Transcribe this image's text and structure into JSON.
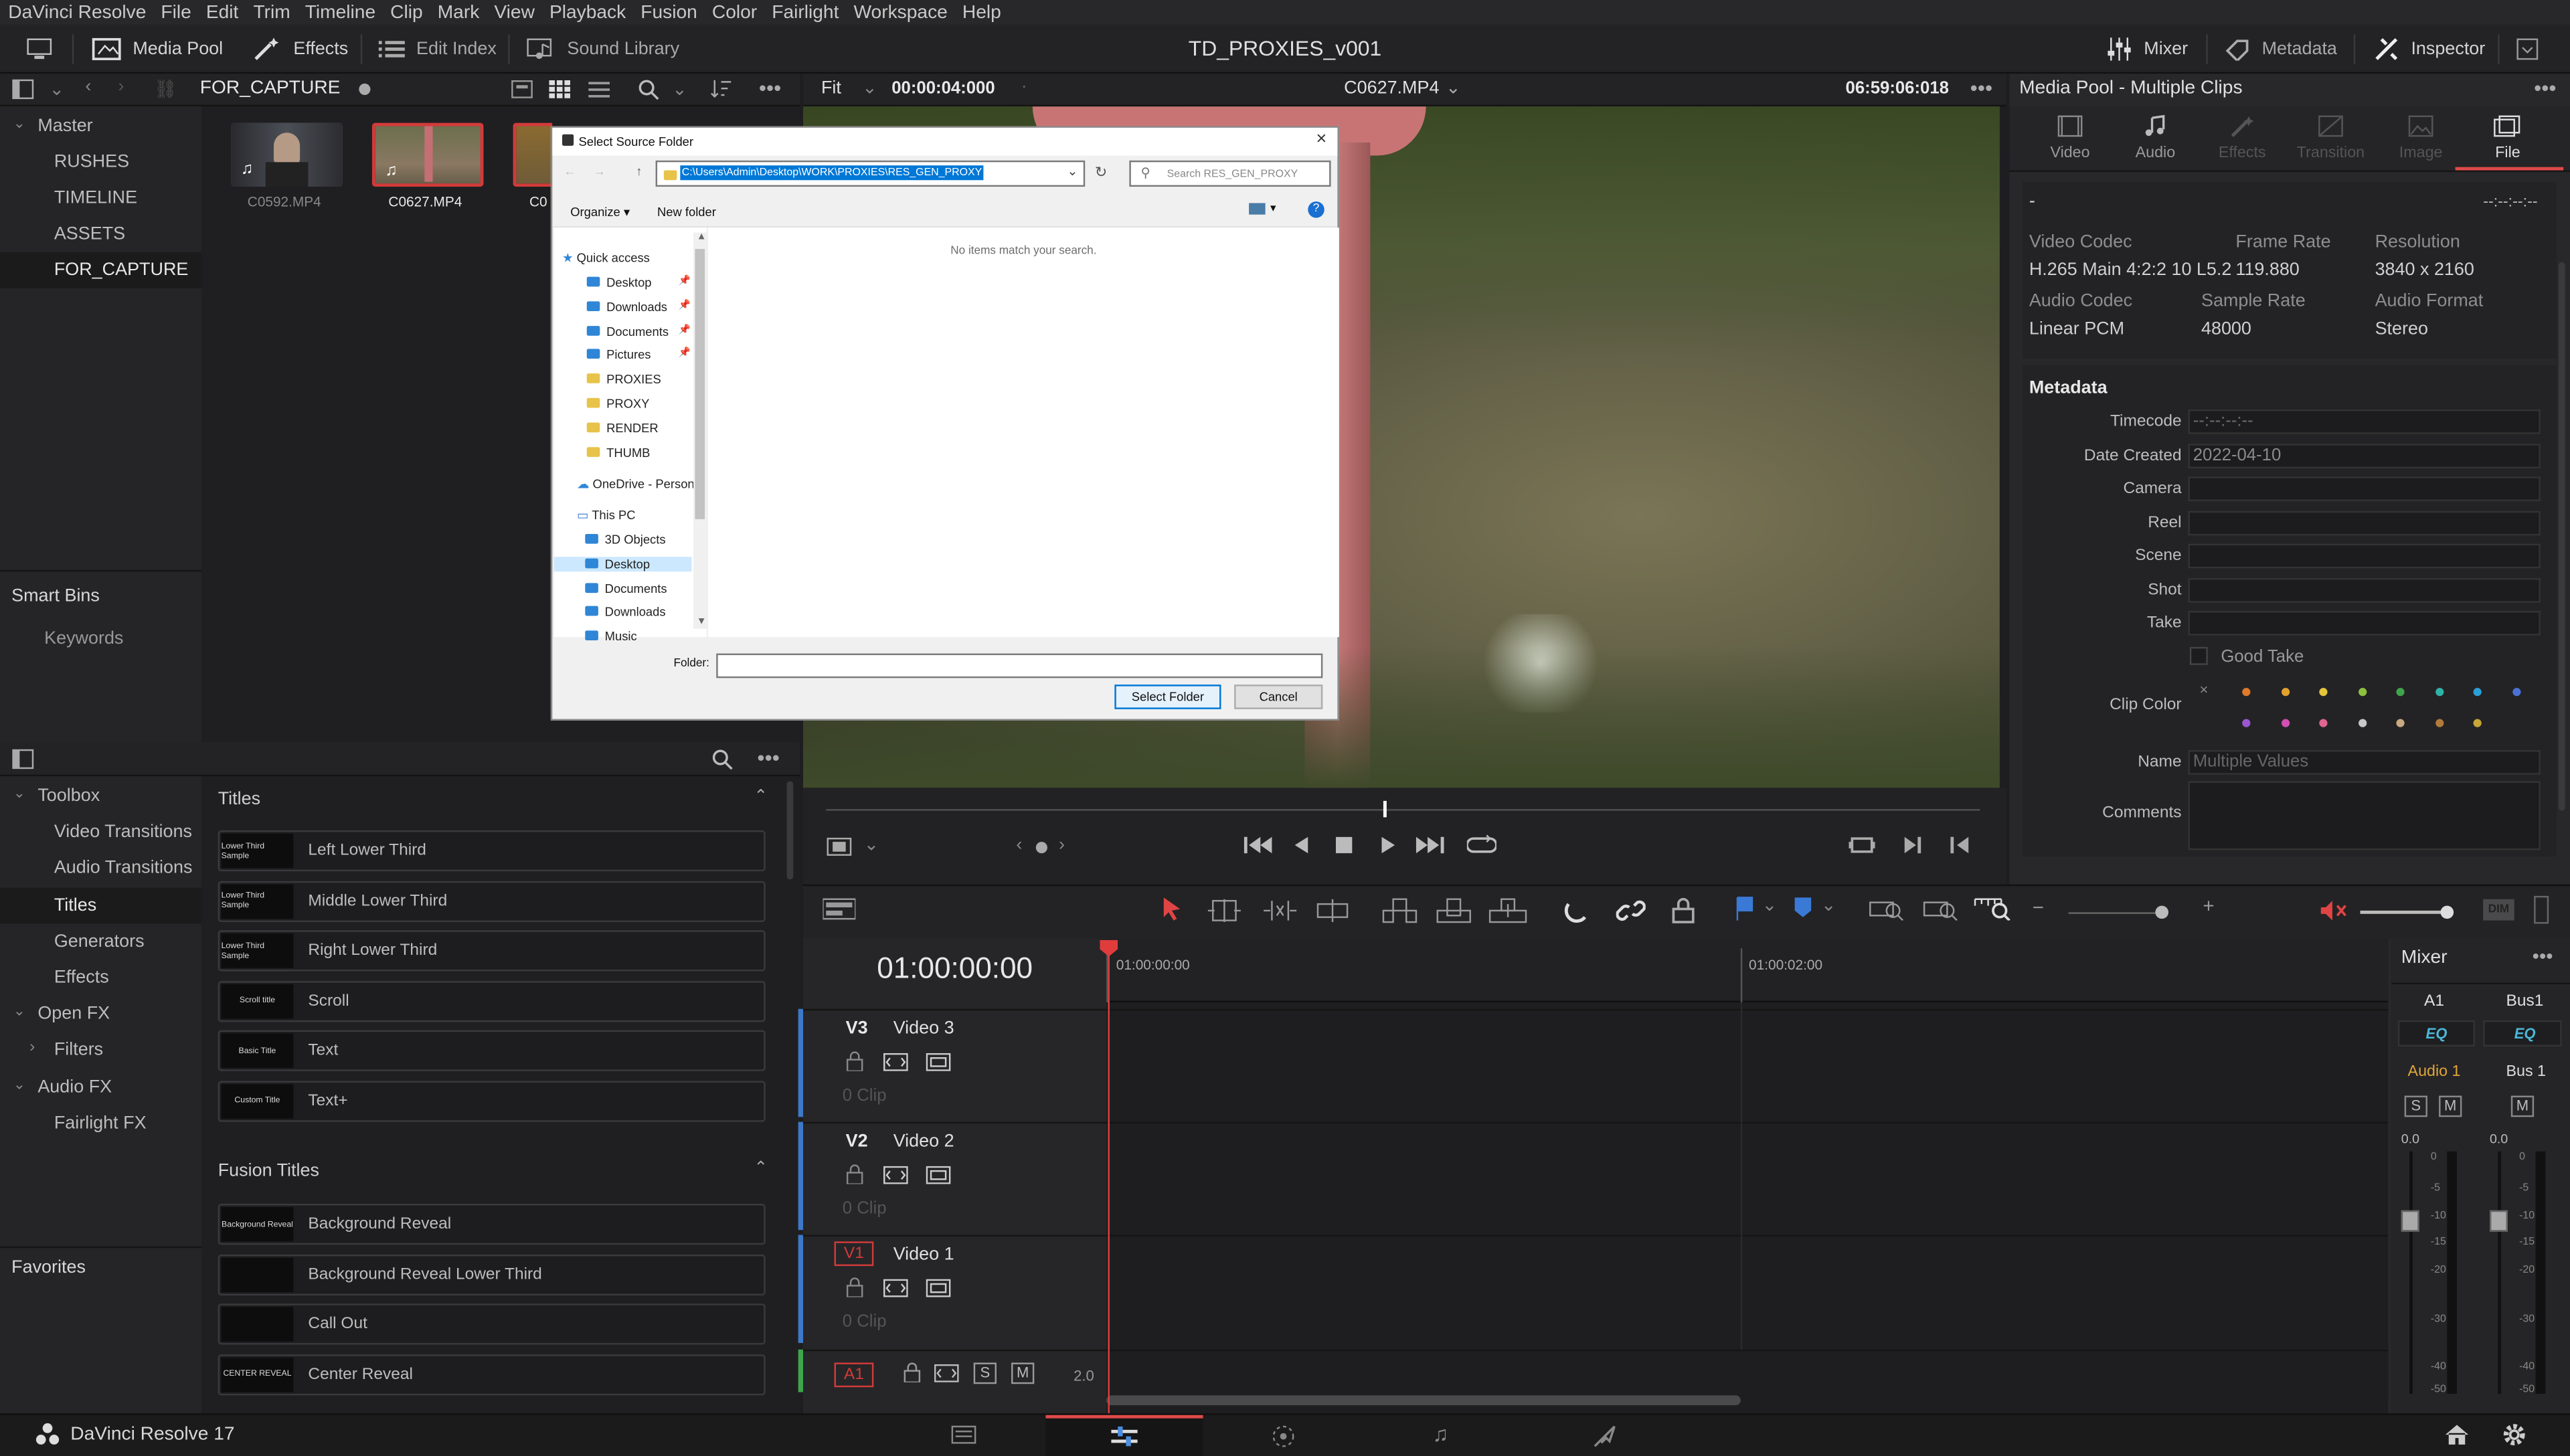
{
  "menu": {
    "app_name": "DaVinci Resolve",
    "items": [
      "File",
      "Edit",
      "Trim",
      "Timeline",
      "Clip",
      "Mark",
      "View",
      "Playback",
      "Fusion",
      "Color",
      "Fairlight",
      "Workspace",
      "Help"
    ]
  },
  "toolbar": {
    "media_pool": "Media Pool",
    "effects": "Effects",
    "edit_index": "Edit Index",
    "sound_library": "Sound Library",
    "project_title": "TD_PROXIES_v001",
    "mixer": "Mixer",
    "metadata": "Metadata",
    "inspector": "Inspector"
  },
  "media_pool": {
    "current_bin": "FOR_CAPTURE",
    "bins": [
      {
        "label": "Master"
      },
      {
        "label": "RUSHES"
      },
      {
        "label": "TIMELINE"
      },
      {
        "label": "ASSETS"
      },
      {
        "label": "FOR_CAPTURE"
      }
    ],
    "smart_bins_label": "Smart Bins",
    "keywords_label": "Keywords",
    "clips": [
      {
        "name": "C0592.MP4"
      },
      {
        "name": "C0627.MP4"
      },
      {
        "name": "C0"
      }
    ]
  },
  "viewer": {
    "fit_label": "Fit",
    "source_tc": "00:00:04:000",
    "clip_name": "C0627.MP4",
    "record_tc": "06:59:06:018"
  },
  "dialog": {
    "title": "Select Source Folder",
    "path": "C:\\Users\\Admin\\Desktop\\WORK\\PROXIES\\RES_GEN_PROXY",
    "search_placeholder": "Search RES_GEN_PROXY",
    "organize": "Organize",
    "new_folder": "New folder",
    "empty_message": "No items match your search.",
    "nav": {
      "quick_access": "Quick access",
      "quick_items": [
        "Desktop",
        "Downloads",
        "Documents",
        "Pictures",
        "PROXIES",
        "PROXY",
        "RENDER",
        "THUMB"
      ],
      "onedrive": "OneDrive - Person",
      "this_pc": "This PC",
      "pc_items": [
        "3D Objects",
        "Desktop",
        "Documents",
        "Downloads",
        "Music"
      ]
    },
    "folder_label": "Folder:",
    "select_button": "Select Folder",
    "cancel_button": "Cancel"
  },
  "effects": {
    "toolbox": "Toolbox",
    "tree": [
      "Video Transitions",
      "Audio Transitions",
      "Titles",
      "Generators",
      "Effects",
      "Open FX",
      "Filters",
      "Audio FX",
      "Fairlight FX"
    ],
    "favorites": "Favorites",
    "titles_header": "Titles",
    "titles": [
      {
        "thumb": "Lower Third Sample",
        "label": "Left Lower Third"
      },
      {
        "thumb": "Lower Third Sample",
        "label": "Middle Lower Third"
      },
      {
        "thumb": "Lower Third Sample",
        "label": "Right Lower Third"
      },
      {
        "thumb": "Scroll title",
        "label": "Scroll"
      },
      {
        "thumb": "Basic Title",
        "label": "Text"
      },
      {
        "thumb": "Custom Title",
        "label": "Text+"
      }
    ],
    "fusion_header": "Fusion Titles",
    "fusion_titles": [
      {
        "thumb": "Background Reveal",
        "label": "Background Reveal"
      },
      {
        "thumb": "",
        "label": "Background Reveal Lower Third"
      },
      {
        "thumb": "",
        "label": "Call Out"
      },
      {
        "thumb": "CENTER REVEAL",
        "label": "Center Reveal"
      }
    ]
  },
  "inspector": {
    "title": "Media Pool - Multiple Clips",
    "tabs": [
      "Video",
      "Audio",
      "Effects",
      "Transition",
      "Image",
      "File"
    ],
    "dash": "-",
    "tc_placeholder": "--:--:--:--",
    "video_codec_label": "Video Codec",
    "video_codec": "H.265 Main 4:2:2 10 L5.2",
    "frame_rate_label": "Frame Rate",
    "frame_rate": "119.880",
    "resolution_label": "Resolution",
    "resolution": "3840 x 2160",
    "audio_codec_label": "Audio Codec",
    "audio_codec": "Linear PCM",
    "sample_rate_label": "Sample Rate",
    "sample_rate": "48000",
    "audio_format_label": "Audio Format",
    "audio_format": "Stereo",
    "metadata_header": "Metadata",
    "fields": {
      "timecode_label": "Timecode",
      "timecode": "--:--:--:--",
      "date_label": "Date Created",
      "date": "2022-04-10",
      "camera_label": "Camera",
      "reel_label": "Reel",
      "scene_label": "Scene",
      "shot_label": "Shot",
      "take_label": "Take",
      "good_take": "Good Take",
      "clip_color_label": "Clip Color",
      "name_label": "Name",
      "name_placeholder": "Multiple Values",
      "comments_label": "Comments"
    },
    "clip_colors": [
      "#e07a2a",
      "#e3a12d",
      "#e4c53a",
      "#8dc03c",
      "#3fa54a",
      "#2fb3a9",
      "#2a9fd6",
      "#4a72d6",
      "#9a57d1",
      "#d14fb3",
      "#e0668f",
      "#c7c7c7",
      "#c9a982",
      "#b27a3a",
      "#c7a63a"
    ]
  },
  "timeline": {
    "timecode": "01:00:00:00",
    "ruler": [
      "01:00:00:00",
      "01:00:02:00"
    ],
    "tracks": [
      {
        "code": "V3",
        "name": "Video 3",
        "clips": "0 Clip"
      },
      {
        "code": "V2",
        "name": "Video 2",
        "clips": "0 Clip"
      },
      {
        "code": "V1",
        "name": "Video 1",
        "clips": "0 Clip"
      }
    ],
    "audio_track": {
      "code": "A1",
      "solo": "S",
      "mute": "M",
      "value": "2.0"
    }
  },
  "mixer": {
    "title": "Mixer",
    "ch1": "A1",
    "ch2": "Bus1",
    "eq": "EQ",
    "ch1_name": "Audio 1",
    "ch2_name": "Bus 1",
    "solo": "S",
    "mute": "M",
    "level": "0.0",
    "scale": [
      "0",
      "-5",
      "-10",
      "-15",
      "-20",
      "-30",
      "-40",
      "-50"
    ]
  },
  "footer": {
    "app_label": "DaVinci Resolve 17"
  },
  "colors": {
    "accent": "#e64b4b",
    "playhead": "#e03c3c",
    "selection": "#3a76d6"
  }
}
